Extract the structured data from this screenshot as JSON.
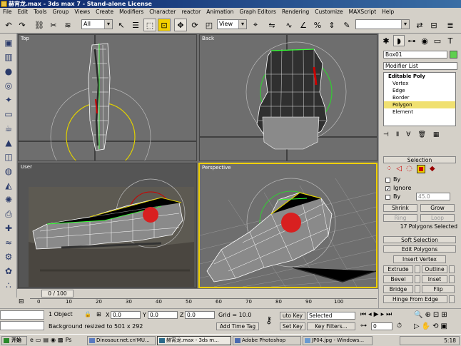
{
  "window": {
    "title": "赫宵龙.max - 3ds max 7  - Stand-alone License"
  },
  "menu": [
    "File",
    "Edit",
    "Tools",
    "Group",
    "Views",
    "Create",
    "Modifiers",
    "Character",
    "reactor",
    "Animation",
    "Graph Editors",
    "Rendering",
    "Customize",
    "MAXScript",
    "Help"
  ],
  "toolbar": {
    "selection_filter": "All",
    "coord_system": "View"
  },
  "viewports": {
    "top": {
      "label": "Top"
    },
    "back": {
      "label": "Back"
    },
    "user": {
      "label": "User"
    },
    "perspective": {
      "label": "Perspective"
    }
  },
  "command_panel": {
    "object_name": "Box01",
    "modifier_list": "Modifier List",
    "stack": {
      "root": "Editable Poly",
      "items": [
        "Vertex",
        "Edge",
        "Border",
        "Polygon",
        "Element"
      ],
      "selected": "Polygon"
    },
    "selection": {
      "title": "Selection",
      "by_vertex_label": "By",
      "ignore_label": "Ignore",
      "by_angle_label": "By",
      "angle_value": "45.0",
      "shrink": "Shrink",
      "grow": "Grow",
      "ring": "Ring",
      "loop": "Loop",
      "status": "17 Polygons Selected"
    },
    "soft_selection": {
      "title": "Soft Selection"
    },
    "edit_polygons": {
      "title": "Edit Polygons",
      "insert_vertex": "Insert Vertex",
      "extrude": "Extrude",
      "outline": "Outline",
      "bevel": "Bevel",
      "inset": "Inset",
      "bridge": "Bridge",
      "flip": "Flip",
      "hinge": "Hinge From Edge"
    }
  },
  "timeline": {
    "slider": "0 / 100",
    "ticks": [
      "0",
      "10",
      "20",
      "30",
      "40",
      "50",
      "60",
      "70",
      "80",
      "90",
      "100"
    ]
  },
  "status": {
    "objects": "1 Object",
    "x_label": "X",
    "x": "0.0",
    "y_label": "Y",
    "y": "0.0",
    "z_label": "Z",
    "z": "0.0",
    "grid": "Grid = 10.0",
    "prompt": "Background resized to 501 x 292",
    "add_time_tag": "Add Time Tag",
    "auto_key": "uto Key",
    "selected": "Selected",
    "set_key": "Set Key",
    "key_filters": "Key Filters...",
    "frame": "0"
  },
  "taskbar": {
    "start": "开始",
    "tasks": [
      "Dinosaur.net.cn'MU...",
      "赫宵龙.max - 3ds m...",
      "Adobe Photoshop",
      "JP04.jpg - Windows..."
    ],
    "clock": "5:18"
  },
  "colors": {
    "select_yellow": "#f0d000",
    "title_blue": "#0a246a",
    "viewport_bg": "#6e6e6e"
  }
}
